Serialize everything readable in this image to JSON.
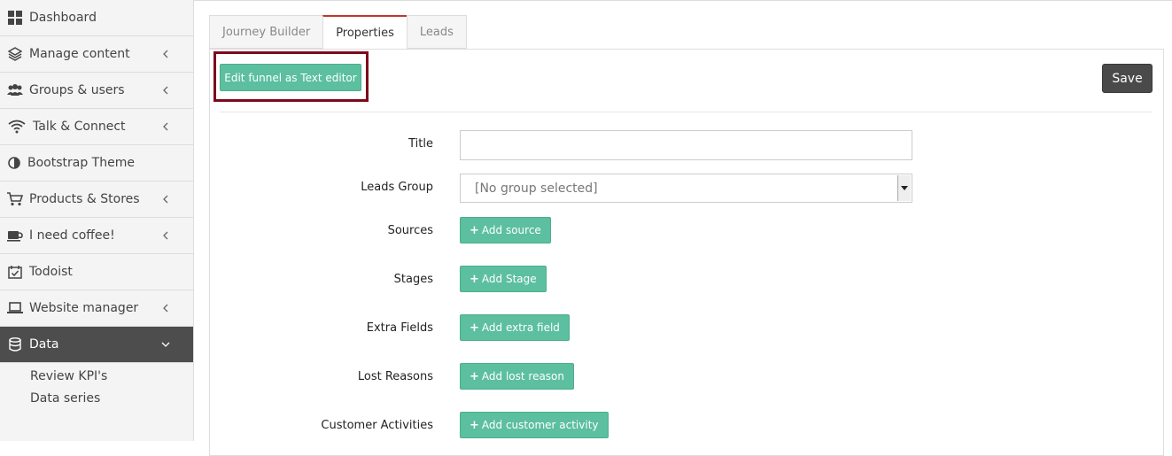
{
  "sidebar": {
    "items": [
      {
        "label": "Dashboard",
        "icon": "dashboard-icon"
      },
      {
        "label": "Manage content",
        "icon": "layers-icon"
      },
      {
        "label": "Groups & users",
        "icon": "users-icon"
      },
      {
        "label": "Talk & Connect",
        "icon": "wifi-icon"
      },
      {
        "label": "Bootstrap Theme",
        "icon": "contrast-icon"
      },
      {
        "label": "Products & Stores",
        "icon": "cart-icon"
      },
      {
        "label": "I need coffee!",
        "icon": "coffee-icon"
      },
      {
        "label": "Todoist",
        "icon": "calendar-check-icon"
      },
      {
        "label": "Website manager",
        "icon": "laptop-icon"
      },
      {
        "label": "Data",
        "icon": "database-icon"
      }
    ],
    "sub_items": [
      "Review KPI's",
      "Data series"
    ]
  },
  "tabs": [
    "Journey Builder",
    "Properties",
    "Leads"
  ],
  "toolbar": {
    "edit_label": "Edit funnel as Text editor",
    "save_label": "Save"
  },
  "form": {
    "title_label": "Title",
    "title_value": "",
    "leads_group_label": "Leads Group",
    "leads_group_value": "[No group selected]",
    "sources_label": "Sources",
    "sources_button": "Add source",
    "stages_label": "Stages",
    "stages_button": "Add Stage",
    "extra_fields_label": "Extra Fields",
    "extra_fields_button": "Add extra field",
    "lost_reasons_label": "Lost Reasons",
    "lost_reasons_button": "Add lost reason",
    "customer_activities_label": "Customer Activities",
    "customer_activities_button": "Add customer activity"
  },
  "colors": {
    "accent_green": "#5cbf9f",
    "active_tab_border": "#c0392b",
    "highlight_border": "#7d0a1c",
    "save_button": "#4a4a4a",
    "sidebar_active": "#4d4d4d"
  }
}
